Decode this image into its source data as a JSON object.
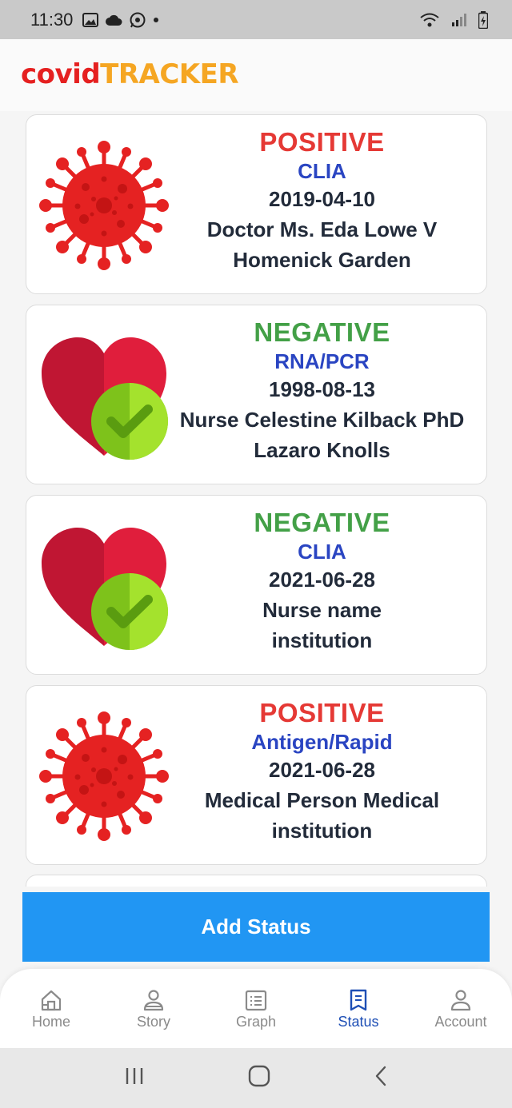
{
  "statusbar": {
    "time": "11:30"
  },
  "header": {
    "logo_part1": "covid",
    "logo_part2": "TRACKER"
  },
  "cards": [
    {
      "status": "POSITIVE",
      "type": "CLIA",
      "date": "2019-04-10",
      "person": "Doctor Ms. Eda Lowe V",
      "institution": "Homenick Garden",
      "icon": "virus-icon"
    },
    {
      "status": "NEGATIVE",
      "type": "RNA/PCR",
      "date": "1998-08-13",
      "person": "Nurse Celestine Kilback PhD",
      "institution": "Lazaro Knolls",
      "icon": "heart-check-icon"
    },
    {
      "status": "NEGATIVE",
      "type": "CLIA",
      "date": "2021-06-28",
      "person": "Nurse name",
      "institution": "institution",
      "icon": "heart-check-icon"
    },
    {
      "status": "POSITIVE",
      "type": "Antigen/Rapid",
      "date": "2021-06-28",
      "person": "Medical Person Medical",
      "institution": "institution",
      "icon": "virus-icon"
    }
  ],
  "colors": {
    "positive": "#e53935",
    "negative": "#43a047",
    "type": "#2a45c2",
    "accent": "#2196f3",
    "nav_active": "#1e4fb5"
  },
  "add_button": {
    "label": "Add Status"
  },
  "nav": [
    {
      "label": "Home",
      "icon": "home-icon"
    },
    {
      "label": "Story",
      "icon": "person-icon"
    },
    {
      "label": "Graph",
      "icon": "clipboard-icon"
    },
    {
      "label": "Status",
      "icon": "bookmark-doc-icon",
      "active": true
    },
    {
      "label": "Account",
      "icon": "account-icon"
    }
  ]
}
